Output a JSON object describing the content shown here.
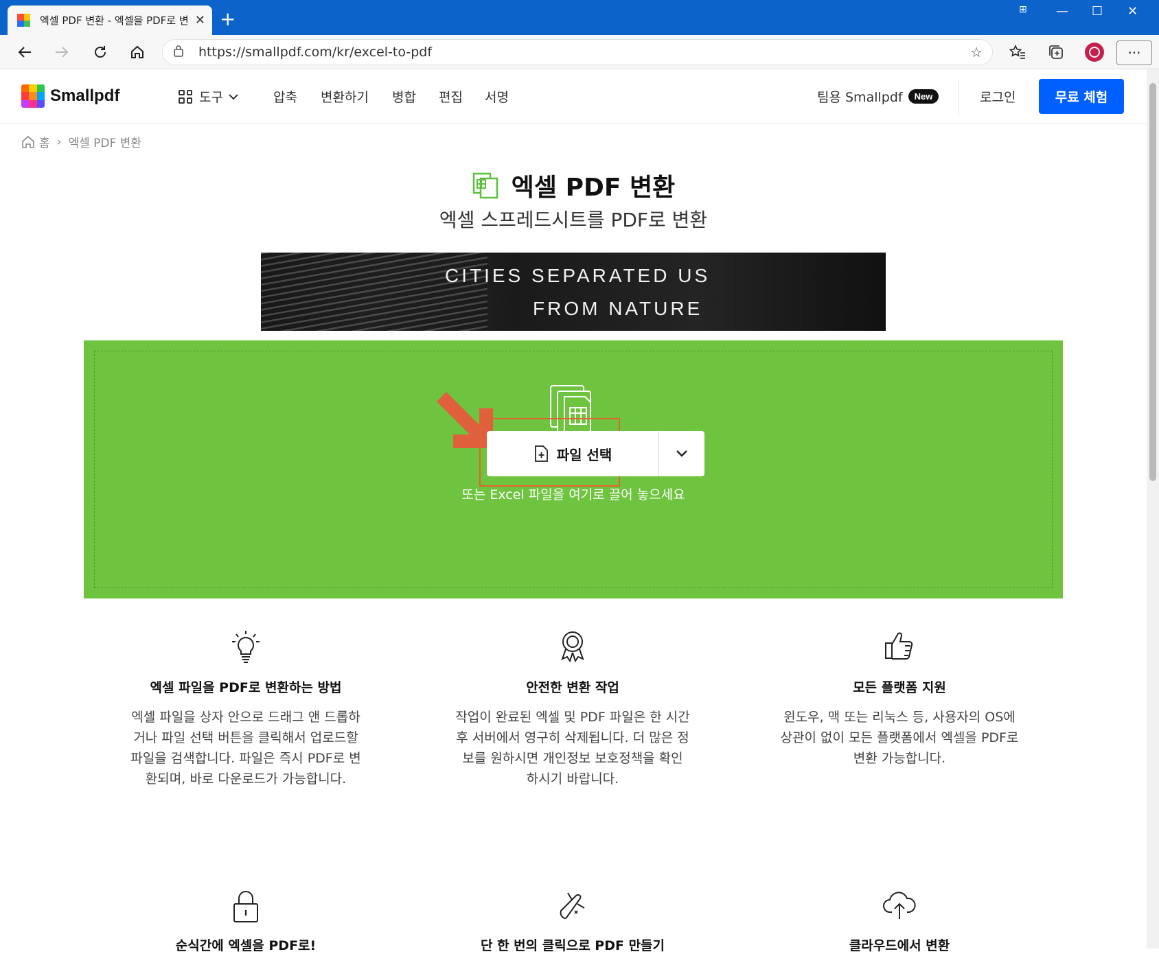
{
  "browser": {
    "tab_title": "엑셀 PDF 변환 - 엑셀을 PDF로 변",
    "url": "https://smallpdf.com/kr/excel-to-pdf"
  },
  "header": {
    "brand": "Smallpdf",
    "nav": [
      "도구",
      "압축",
      "변환하기",
      "병합",
      "편집",
      "서명"
    ],
    "team_label": "팀용 Smallpdf",
    "team_badge": "New",
    "login": "로그인",
    "cta": "무료 체험"
  },
  "breadcrumb": {
    "home": "홈",
    "current": "엑셀 PDF 변환"
  },
  "hero": {
    "title": "엑셀 PDF 변환",
    "subtitle": "엑셀 스프레드시트를 PDF로 변환"
  },
  "ad": {
    "line1": "CITIES SEPARATED US",
    "line2": "FROM NATURE"
  },
  "dropzone": {
    "button_label": "파일 선택",
    "hint": "또는 Excel 파일을 여기로 끌어 놓으세요"
  },
  "features": [
    {
      "icon": "lightbulb-icon",
      "title": "엑셀 파일을 PDF로 변환하는 방법",
      "lines": [
        "엑셀 파일을 상자 안으로 드래그 앤 드롭하",
        "거나 파일 선택 버튼을 클릭해서 업로드할",
        "파일을 검색합니다. 파일은 즉시 PDF로 변",
        "환되며, 바로 다운로드가 가능합니다."
      ]
    },
    {
      "icon": "award-icon",
      "title": "안전한 변환 작업",
      "lines": [
        "작업이 완료된 엑셀 및 PDF 파일은 한 시간",
        "후 서버에서 영구히 삭제됩니다. 더 많은 정",
        "보를 원하시면 개인정보 보호정책을 확인",
        "하시기 바랍니다."
      ]
    },
    {
      "icon": "thumbs-up-icon",
      "title": "모든 플랫폼 지원",
      "lines": [
        "윈도우, 맥 또는 리눅스 등, 사용자의 OS에",
        "상관이 없이 모든 플랫폼에서 엑셀을 PDF로",
        "변환 가능합니다."
      ]
    }
  ],
  "features2": [
    {
      "icon": "lock-icon",
      "title": "순식간에 엑셀을 PDF로!"
    },
    {
      "icon": "swiss-knife-icon",
      "title": "단 한 번의 클릭으로 PDF 만들기"
    },
    {
      "icon": "cloud-upload-icon",
      "title": "클라우드에서 변환"
    }
  ],
  "colors": {
    "brand_blue": "#0060ff",
    "dropzone_green": "#6ec43f",
    "titlebar": "#0c63c9",
    "highlight": "#e1632f"
  }
}
